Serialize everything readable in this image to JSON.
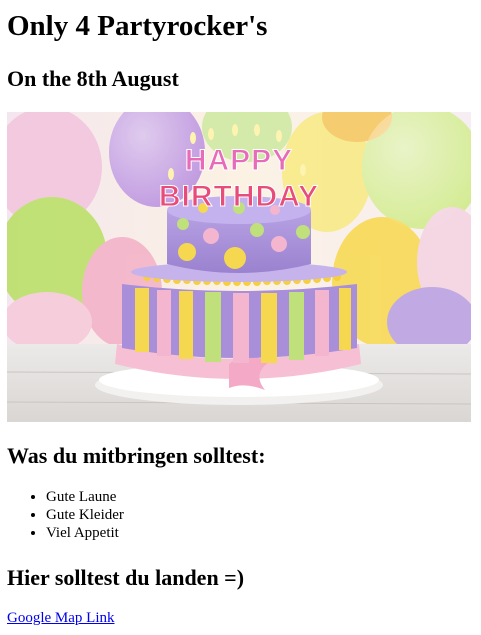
{
  "header": {
    "title": "Only 4 Partyrocker's",
    "date": "On the 8th August"
  },
  "hero": {
    "candles_text": "HAPPY BIRTHDAY",
    "candles_line1": "HAPPY",
    "candles_line2": "BIRTHDAY"
  },
  "bring": {
    "heading": "Was du mitbringen solltest:",
    "items": [
      "Gute Laune",
      "Gute Kleider",
      "Viel Appetit"
    ]
  },
  "location": {
    "heading": "Hier solltest du landen =)",
    "link_text": "Google Map Link"
  },
  "colors": {
    "link": "#0000ee",
    "cake_purple": "#a98fd9",
    "cake_yellow": "#f5d84f",
    "cake_pink": "#f4b6cf",
    "cake_green": "#bfe07a"
  }
}
